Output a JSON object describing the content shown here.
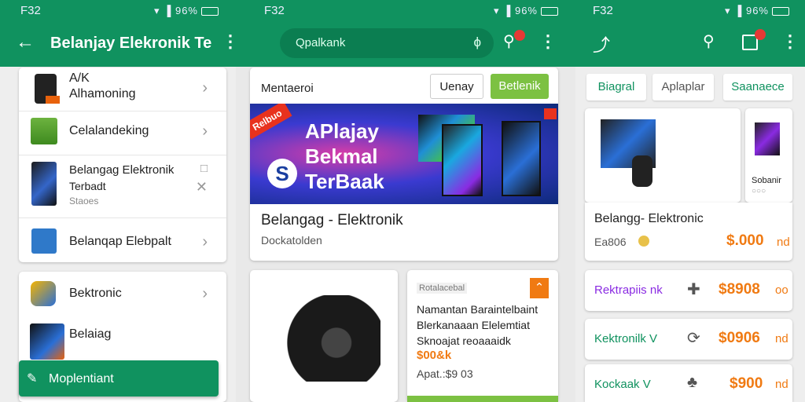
{
  "left": {
    "status": {
      "time": "F32",
      "icons": "▾ ▐ 96%"
    },
    "title": "Belanjay Elekronik Te",
    "items": [
      {
        "label": "A/K\nAlhamoning"
      },
      {
        "label": "Celalandeking"
      },
      {
        "label": "Belangag Elektronik",
        "sub1": "Terbadt",
        "sub2": "Staoes"
      },
      {
        "label": "Belanqap Elebpalt"
      },
      {
        "label": "Bektronic"
      },
      {
        "label": "Belaiag"
      }
    ],
    "fab_label": "Moplentiant"
  },
  "middle": {
    "status": {
      "time": "F32",
      "icons": "▾ ▐ 96%"
    },
    "search_placeholder": "Qpalkank",
    "filter_label": "Mentaeroi",
    "btn_outline": "Uenay",
    "btn_green": "Betlenik",
    "banner_badge": "Relbuo",
    "banner_lines": [
      "APlajay",
      "Bekmal",
      "TerBaak"
    ],
    "hero_title": "Belangag - Elektronik",
    "hero_sub": "Dockatolden",
    "product_tag": "Rotalacebal",
    "product_desc": [
      "Namantan Baraintelbaint",
      "Blerkanaaan Elelemtiat",
      "Sknoajat reoaaaidk"
    ],
    "product_price": "$00&k",
    "product_meta": "Apat.:$9 03"
  },
  "right": {
    "status": {
      "time": "F32",
      "icons": "▾ ▐ 96%"
    },
    "chips": [
      "Biagral",
      "Aplaplar",
      "Saanaece"
    ],
    "side_label": "Sobanir",
    "product_title": "Belangg- Elektronic",
    "product_code": "Ea806",
    "product_price": "$.000",
    "product_unit": "nd",
    "items": [
      {
        "name": "Rektrapiis nk",
        "price": "$8908",
        "unit": "oo",
        "color": "#8a2be2"
      },
      {
        "name": "Kektronilk V",
        "price": "$0906",
        "unit": "nd",
        "color": "#10925f"
      },
      {
        "name": "Kockaak V",
        "price": "$900",
        "unit": "nd",
        "color": "#10925f"
      }
    ]
  }
}
